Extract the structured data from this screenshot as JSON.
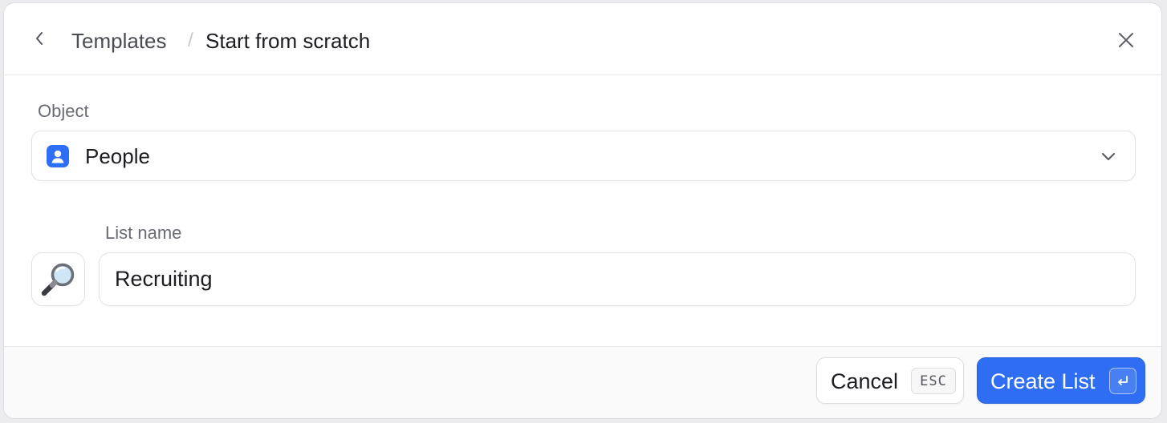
{
  "header": {
    "back_icon": "chevron-left-icon",
    "breadcrumb_parent": "Templates",
    "breadcrumb_separator": "/",
    "breadcrumb_current": "Start from scratch",
    "close_icon": "close-icon"
  },
  "object_field": {
    "label": "Object",
    "value": "People",
    "icon": "person-icon",
    "icon_color": "#2e6df6",
    "dropdown_icon": "chevron-down-icon"
  },
  "list_name_field": {
    "label": "List name",
    "value": "Recruiting",
    "emoji": "🔎",
    "emoji_icon": "magnifying-glass-icon"
  },
  "footer": {
    "cancel_label": "Cancel",
    "cancel_shortcut": "ESC",
    "create_label": "Create List",
    "create_shortcut_icon": "enter-key-icon",
    "accent_color": "#2f6ef2"
  }
}
